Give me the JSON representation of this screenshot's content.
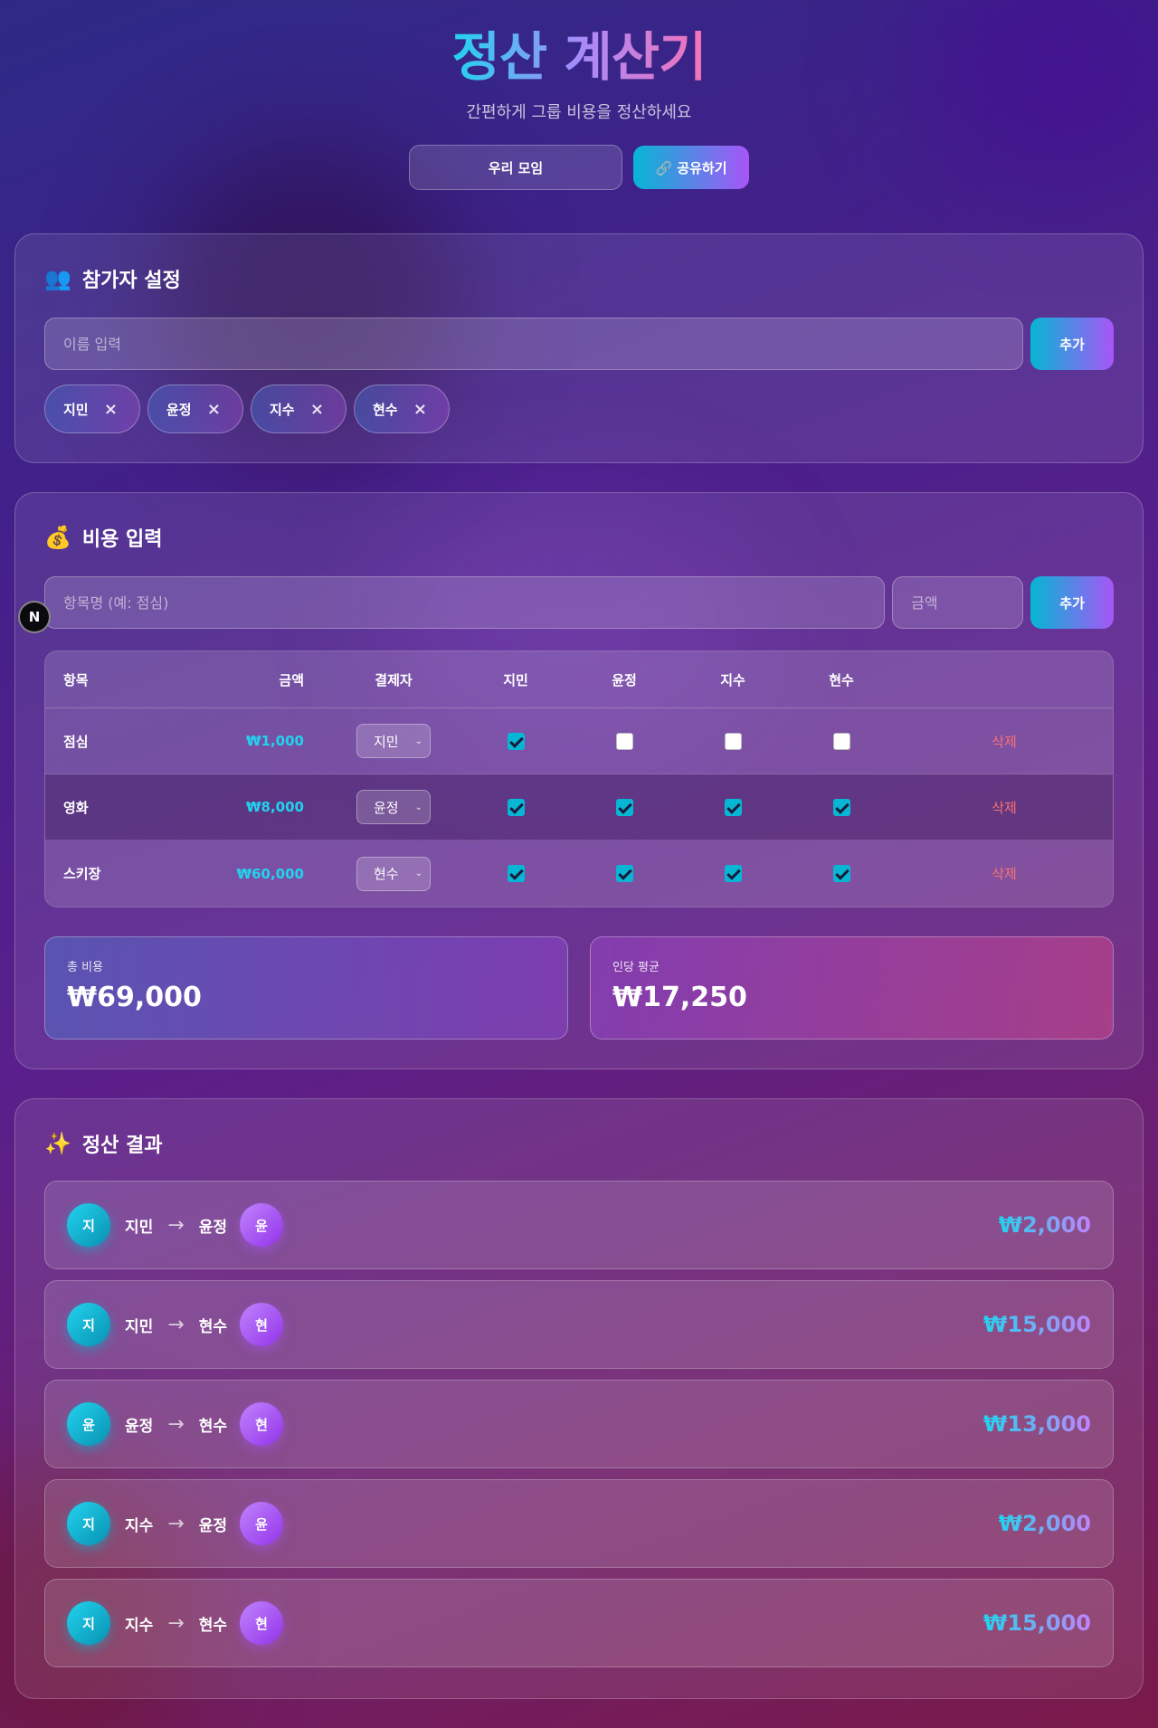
{
  "header": {
    "title": "정산 계산기",
    "subtitle": "간편하게 그룹 비용을 정산하세요",
    "group_name": "우리 모임",
    "share_label": "🔗 공유하기"
  },
  "participants": {
    "title": "참가자 설정",
    "icon": "people-icon",
    "name_placeholder": "이름 입력",
    "add_label": "추가",
    "remove_symbol": "×",
    "list": [
      "지민",
      "윤정",
      "지수",
      "현수"
    ]
  },
  "expenses": {
    "title": "비용 입력",
    "icon": "money-bag-icon",
    "item_placeholder": "항목명 (예: 점심)",
    "amount_placeholder": "금액",
    "add_label": "추가",
    "columns": [
      "항목",
      "금액",
      "결제자",
      "지민",
      "윤정",
      "지수",
      "현수"
    ],
    "delete_label": "삭제",
    "rows": [
      {
        "name": "점심",
        "amount": "₩1,000",
        "payer": "지민",
        "checks": [
          true,
          false,
          false,
          false
        ]
      },
      {
        "name": "영화",
        "amount": "₩8,000",
        "payer": "윤정",
        "checks": [
          true,
          true,
          true,
          true
        ]
      },
      {
        "name": "스키장",
        "amount": "₩60,000",
        "payer": "현수",
        "checks": [
          true,
          true,
          true,
          true
        ]
      }
    ],
    "total_label": "총 비용",
    "total_value": "₩69,000",
    "avg_label": "인당 평균",
    "avg_value": "₩17,250"
  },
  "results": {
    "title": "정산 결과",
    "icon": "sparkles-icon",
    "arrow": "→",
    "transfers": [
      {
        "from": "지민",
        "from_initial": "지",
        "to": "윤정",
        "to_initial": "윤",
        "amount": "₩2,000"
      },
      {
        "from": "지민",
        "from_initial": "지",
        "to": "현수",
        "to_initial": "현",
        "amount": "₩15,000"
      },
      {
        "from": "윤정",
        "from_initial": "윤",
        "to": "현수",
        "to_initial": "현",
        "amount": "₩13,000"
      },
      {
        "from": "지수",
        "from_initial": "지",
        "to": "윤정",
        "to_initial": "윤",
        "amount": "₩2,000"
      },
      {
        "from": "지수",
        "from_initial": "지",
        "to": "현수",
        "to_initial": "현",
        "amount": "₩15,000"
      }
    ]
  },
  "badge": {
    "letter": "N"
  },
  "colors": {
    "accent_cyan": "#22d3ee",
    "accent_purple": "#a855f7",
    "accent_pink": "#f472b6",
    "delete_red": "#f87171"
  }
}
